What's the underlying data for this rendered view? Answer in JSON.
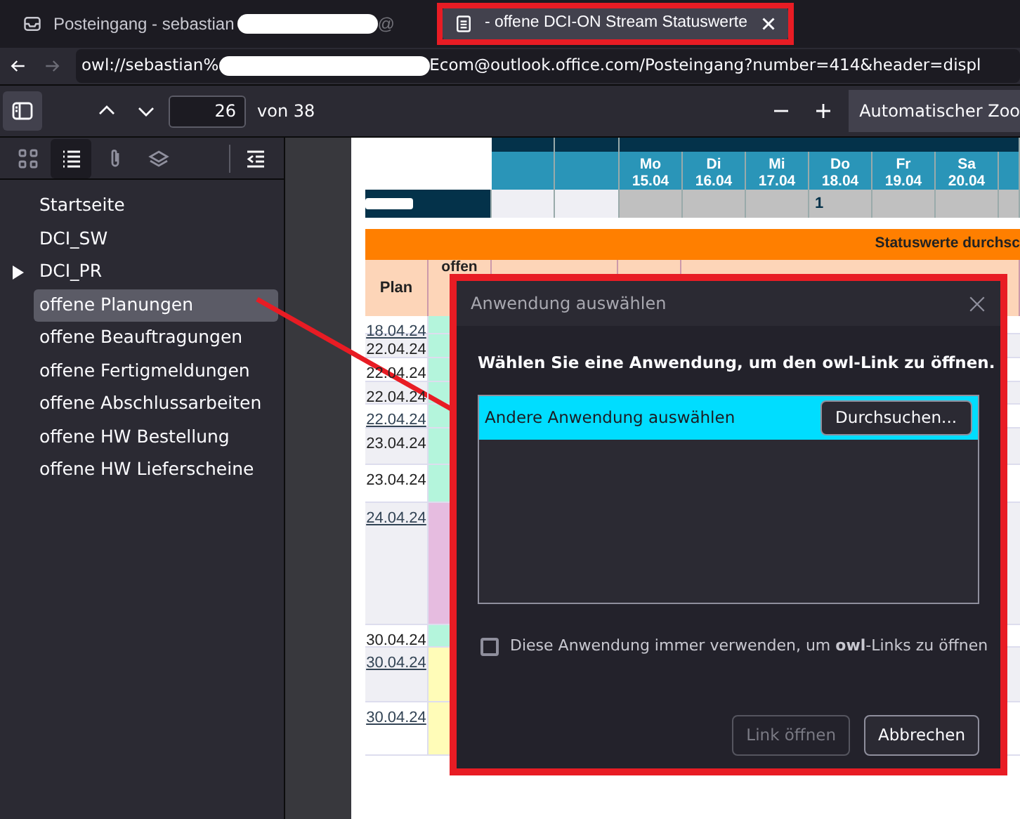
{
  "tabs": [
    {
      "title": "Posteingang - sebastian",
      "tail": "@",
      "kind": "mail",
      "redacted": true,
      "selected": false
    },
    {
      "title": "- offene DCI-ON Stream Statuswerte",
      "kind": "document",
      "redacted": false,
      "selected": true
    }
  ],
  "address_bar": {
    "url_start": "owl://sebastian%",
    "url_end": "Ecom@outlook.office.com/Posteingang?number=414&header=displ"
  },
  "pdf_toolbar": {
    "page": "26",
    "page_count": "von 38",
    "zoom": "Automatischer Zoo"
  },
  "sidebar": {
    "views": [
      {
        "kind": "thumbnails",
        "selected": false
      },
      {
        "kind": "outline",
        "selected": true
      },
      {
        "kind": "attachments",
        "selected": false
      },
      {
        "kind": "layers",
        "selected": false
      }
    ],
    "items": [
      {
        "label": "Startseite",
        "expandable": false,
        "selected": false
      },
      {
        "label": "DCI_SW",
        "expandable": false,
        "selected": false
      },
      {
        "label": "DCI_PR",
        "expandable": true,
        "selected": false
      },
      {
        "label": "offene Planungen",
        "expandable": false,
        "selected": true
      },
      {
        "label": "offene Beauftragungen",
        "expandable": false,
        "selected": false
      },
      {
        "label": "offene Fertigmeldungen",
        "expandable": false,
        "selected": false
      },
      {
        "label": "offene Abschlussarbeiten",
        "expandable": false,
        "selected": false
      },
      {
        "label": "offene HW Bestellung",
        "expandable": false,
        "selected": false
      },
      {
        "label": "offene HW Lieferscheine",
        "expandable": false,
        "selected": false
      }
    ]
  },
  "calendar": {
    "days": [
      {
        "day": "Mo",
        "date": "15.04"
      },
      {
        "day": "Di",
        "date": "16.04"
      },
      {
        "day": "Mi",
        "date": "17.04"
      },
      {
        "day": "Do",
        "date": "18.04",
        "count": "1"
      },
      {
        "day": "Fr",
        "date": "19.04"
      },
      {
        "day": "Sa",
        "date": "20.04"
      }
    ]
  },
  "status_table": {
    "title": "Statuswerte durchsc",
    "columns": [
      "Plan",
      "offen"
    ],
    "rows": [
      {
        "plan": "18.04.24",
        "linked": true,
        "color": "#b4f5dc"
      },
      {
        "plan": "22.04.24",
        "linked": false,
        "color": "#b4f5dc"
      },
      {
        "plan": "22.04.24",
        "linked": false,
        "color": "#b4f5dc"
      },
      {
        "plan": "22.04.24",
        "linked": false,
        "color": "#b4f5dc"
      },
      {
        "plan": "22.04.24",
        "linked": true,
        "color": "#b4f5dc"
      },
      {
        "plan": "23.04.24",
        "linked": false,
        "color": "#b4f5dc"
      },
      {
        "plan": "23.04.24",
        "linked": false,
        "color": "#b4f5dc"
      },
      {
        "plan": "24.04.24",
        "linked": true,
        "color": "#e6bce0"
      },
      {
        "plan": "30.04.24",
        "linked": false,
        "color": "#b4f5dc"
      },
      {
        "plan": "30.04.24",
        "linked": true,
        "color": "#fffcb8"
      },
      {
        "plan": "30.04.24",
        "linked": true,
        "color": "#fffcb8"
      }
    ]
  },
  "dialog": {
    "title": "Anwendung auswählen",
    "prompt": "Wählen Sie eine Anwendung, um den owl-Link zu öffnen.",
    "apps": [
      {
        "label": "Andere Anwendung auswählen",
        "button": "Durchsuchen...",
        "selected": true
      }
    ],
    "remember": {
      "label": "Diese Anwendung immer verwenden, um **owl**-Links zu öffnen",
      "checked": false
    },
    "buttons": [
      {
        "label": "Link öffnen",
        "disabled": true
      },
      {
        "label": "Abbrechen",
        "disabled": false
      }
    ]
  }
}
